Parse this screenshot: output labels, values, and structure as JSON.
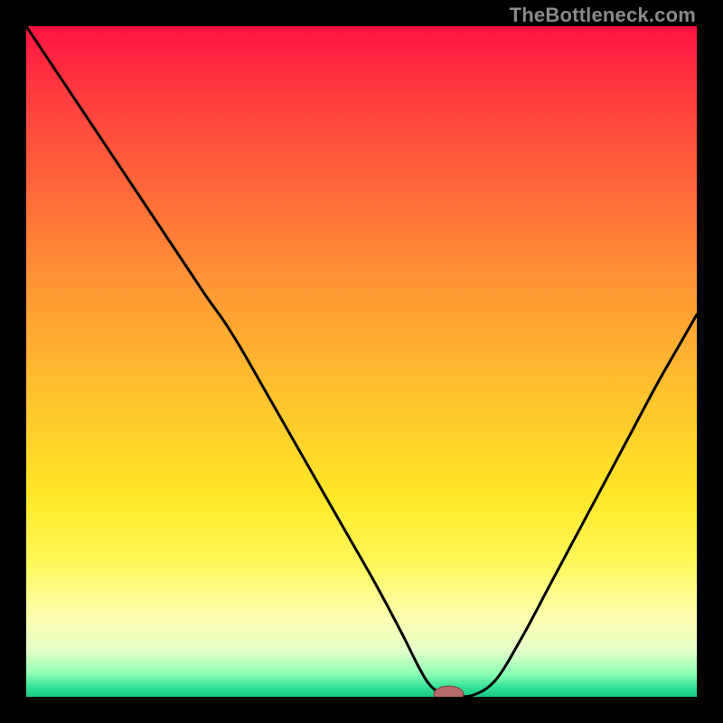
{
  "watermark": "TheBottleneck.com",
  "colors": {
    "black": "#000000",
    "curve": "#000000",
    "marker_fill": "#b76b6a",
    "marker_stroke": "#7a3a3a"
  },
  "chart_data": {
    "type": "line",
    "title": "",
    "xlabel": "",
    "ylabel": "",
    "x_range": [
      0,
      100
    ],
    "y_range": [
      0,
      100
    ],
    "gradient_stops": [
      {
        "offset": 0.0,
        "color": "#ff1240"
      },
      {
        "offset": 0.1,
        "color": "#ff3b3f"
      },
      {
        "offset": 0.25,
        "color": "#ff6a3a"
      },
      {
        "offset": 0.4,
        "color": "#ff9a34"
      },
      {
        "offset": 0.55,
        "color": "#ffc22e"
      },
      {
        "offset": 0.7,
        "color": "#ffe728"
      },
      {
        "offset": 0.8,
        "color": "#fff85a"
      },
      {
        "offset": 0.88,
        "color": "#fdffad"
      },
      {
        "offset": 0.93,
        "color": "#e6ffc9"
      },
      {
        "offset": 0.965,
        "color": "#8fffb4"
      },
      {
        "offset": 0.985,
        "color": "#35e39a"
      },
      {
        "offset": 1.0,
        "color": "#18c985"
      }
    ],
    "series": [
      {
        "name": "bottleneck-curve",
        "x": [
          0.0,
          4.0,
          8.0,
          12.0,
          16.0,
          20.0,
          24.0,
          27.0,
          29.5,
          32.0,
          36.0,
          40.0,
          44.0,
          48.0,
          52.0,
          56.0,
          58.5,
          60.0,
          61.5,
          63.5,
          66.5,
          70.0,
          74.0,
          78.0,
          82.0,
          86.0,
          90.0,
          94.0,
          98.0,
          100.0
        ],
        "y": [
          100.0,
          94.0,
          88.0,
          82.0,
          76.0,
          70.0,
          64.0,
          59.5,
          56.0,
          52.0,
          45.0,
          38.0,
          31.0,
          24.0,
          17.0,
          9.5,
          4.5,
          2.0,
          0.7,
          0.2,
          0.2,
          2.5,
          9.0,
          16.5,
          24.0,
          31.5,
          39.0,
          46.5,
          53.5,
          57.0
        ]
      }
    ],
    "marker": {
      "x": 63.0,
      "y": 0.4,
      "rx": 2.2,
      "ry": 1.2
    },
    "flat_segment": {
      "x_start": 59.5,
      "x_end": 66.5,
      "y": 0.2
    }
  }
}
